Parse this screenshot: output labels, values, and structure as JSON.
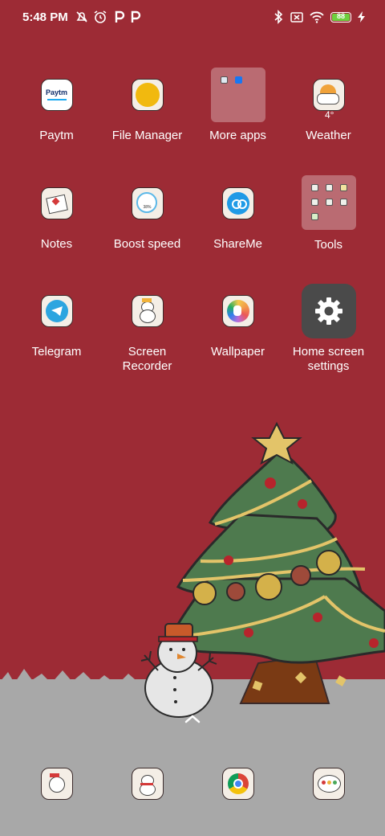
{
  "status_bar": {
    "time": "5:48 PM",
    "battery_level": "88",
    "left_icons": [
      "alarm-off-icon",
      "alarm-clock-icon",
      "p-app-icon",
      "p-app-icon"
    ],
    "right_icons": [
      "bluetooth-icon",
      "no-sim-icon",
      "wifi-icon",
      "battery-icon",
      "charging-icon"
    ]
  },
  "apps": [
    {
      "label": "Paytm",
      "icon": "paytm-icon",
      "logo_text": "Paytm"
    },
    {
      "label": "File Manager",
      "icon": "file-manager-icon"
    },
    {
      "label": "More apps",
      "icon": "folder-icon"
    },
    {
      "label": "Weather",
      "icon": "weather-icon",
      "temp": "4°"
    },
    {
      "label": "Notes",
      "icon": "notes-icon"
    },
    {
      "label": "Boost speed",
      "icon": "boost-speed-icon",
      "percent": "38%"
    },
    {
      "label": "ShareMe",
      "icon": "shareme-icon"
    },
    {
      "label": "Tools",
      "icon": "folder-icon"
    },
    {
      "label": "Telegram",
      "icon": "telegram-icon"
    },
    {
      "label": "Screen\nRecorder",
      "icon": "screen-recorder-icon"
    },
    {
      "label": "Wallpaper",
      "icon": "wallpaper-icon"
    },
    {
      "label": "Home screen\nsettings",
      "icon": "gear-icon"
    }
  ],
  "dock": [
    {
      "icon": "phone-snowman-icon"
    },
    {
      "icon": "messages-snowman-icon"
    },
    {
      "icon": "chrome-icon"
    },
    {
      "icon": "chat-bubble-icon"
    }
  ],
  "colors": {
    "background": "#9d2b35",
    "snow": "#a8a8a8",
    "tree": "#4e7a4e",
    "star": "#e3c469"
  }
}
